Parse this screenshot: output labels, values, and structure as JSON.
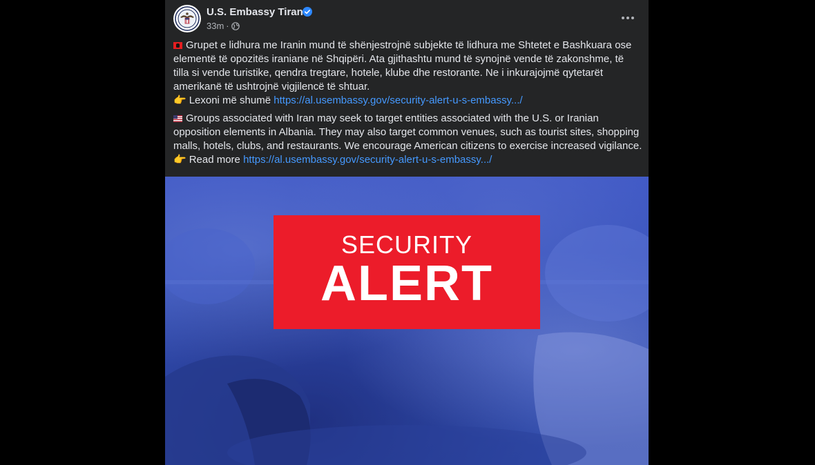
{
  "post": {
    "author": "U.S. Embassy Tirana",
    "time": "33m",
    "dot": "·",
    "icons": {
      "avatar": "embassy-seal-icon",
      "verified": "verified-badge-icon",
      "audience": "globe-icon",
      "more": "more-options-icon"
    },
    "albanian": {
      "lines": [
        "Grupet e lidhura me Iranin mund të shënjestrojnë subjekte të lidhura me Shtetet e Bashkuara ose",
        "elementë të opozitës iraniane në Shqipëri. Ata gjithashtu mund të synojnë vende të zakonshme, të",
        "tilla si vende turistike, qendra tregtare, hotele, klube dhe restorante. Ne i inkurajojmë qytetarët",
        "amerikanë të ushtrojnë vigjilencë të shtuar."
      ],
      "read_more_label": "Lexoni më shumë",
      "link": "https://al.usembassy.gov/security-alert-u-s-embassy.../"
    },
    "english": {
      "lines": [
        "Groups associated with Iran may seek to target entities associated with the U.S. or Iranian",
        "opposition elements in Albania. They may also target common venues, such as tourist sites, shopping",
        "malls, hotels, clubs, and restaurants.  We encourage American citizens to exercise increased vigilance."
      ],
      "read_more_label": "Read more",
      "link": "https://al.usembassy.gov/security-alert-u-s-embassy.../"
    },
    "image": {
      "line1": "SECURITY",
      "line2": "ALERT",
      "box_color": "#ec1c2a",
      "background_color": "#3550b8"
    }
  },
  "colors": {
    "page_bg": "#000000",
    "card_bg": "#242526",
    "text_primary": "#e4e6eb",
    "text_secondary": "#b0b3b8",
    "link": "#4599ff",
    "verified": "#2d88ff"
  }
}
